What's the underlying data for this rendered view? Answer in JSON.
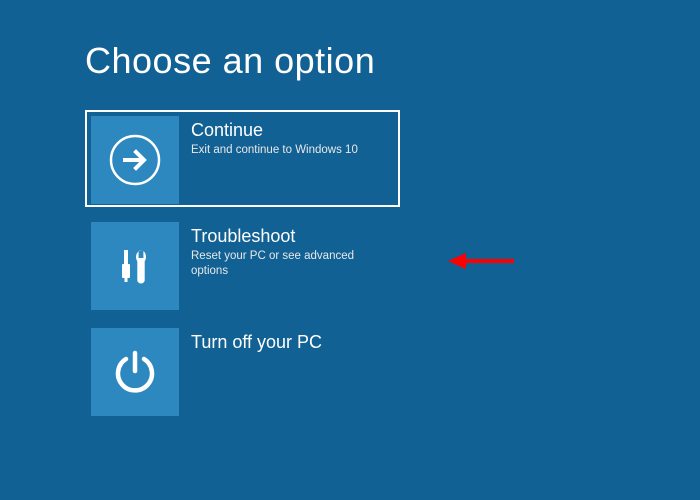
{
  "title": "Choose an option",
  "options": [
    {
      "label": "Continue",
      "desc": "Exit and continue to Windows 10",
      "icon": "arrow-right",
      "selected": true
    },
    {
      "label": "Troubleshoot",
      "desc": "Reset your PC or see advanced options",
      "icon": "tools",
      "selected": false
    },
    {
      "label": "Turn off your PC",
      "desc": "",
      "icon": "power",
      "selected": false
    }
  ],
  "annotation": {
    "color": "#ff0000",
    "target_index": 1
  }
}
